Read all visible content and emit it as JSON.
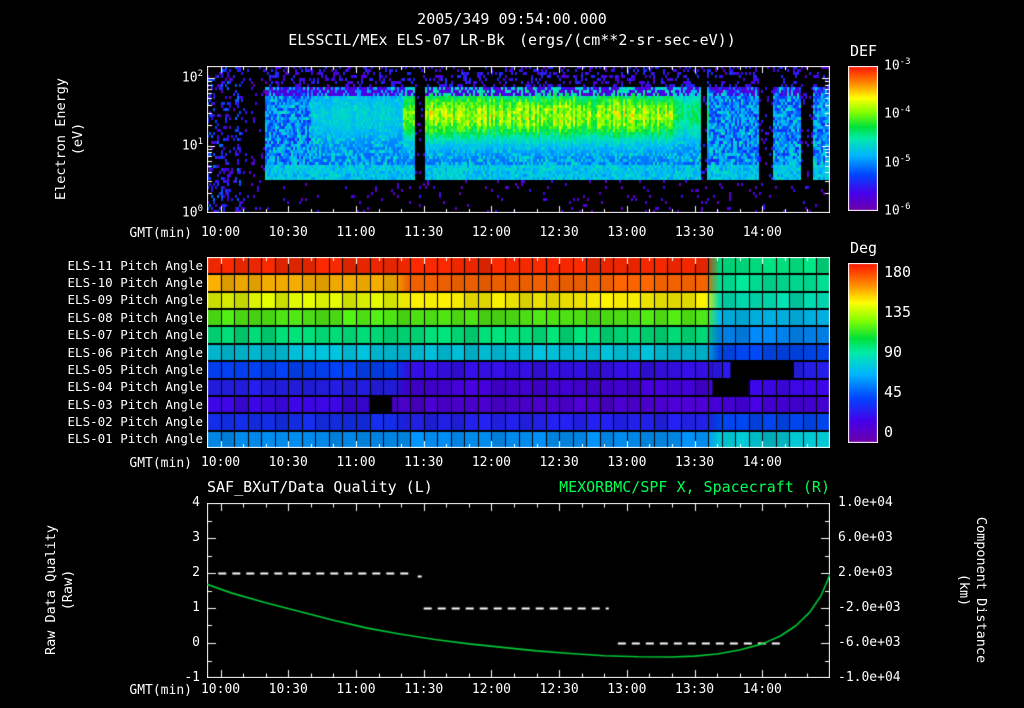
{
  "titles": {
    "datetime": "2005/349 09:54:00.000",
    "instrument": "ELSSCIL/MEx ELS-07 LR-Bk",
    "units": "(ergs/(cm**2-sr-sec-eV))"
  },
  "time_axis": {
    "label": "GMT(min)",
    "start_min": 594,
    "end_min": 870,
    "minor_step_min": 10,
    "major_ticks": [
      {
        "min": 600,
        "label": "10:00"
      },
      {
        "min": 630,
        "label": "10:30"
      },
      {
        "min": 660,
        "label": "11:00"
      },
      {
        "min": 690,
        "label": "11:30"
      },
      {
        "min": 720,
        "label": "12:00"
      },
      {
        "min": 750,
        "label": "12:30"
      },
      {
        "min": 780,
        "label": "13:00"
      },
      {
        "min": 810,
        "label": "13:30"
      },
      {
        "min": 840,
        "label": "14:00"
      }
    ]
  },
  "chart_data": [
    {
      "type": "heatmap",
      "name": "electron-energy-spectrogram",
      "title": "ELSSCIL/MEx ELS-07 LR-Bk",
      "units": "(ergs/(cm**2-sr-sec-eV))",
      "xlabel": "GMT(min)",
      "ylabel": [
        "Electron Energy",
        "(eV)"
      ],
      "y_axis": {
        "scale": "log",
        "min_ev": 1,
        "max_ev": 151,
        "log_max": 2.18,
        "ticks": [
          {
            "exp": "2"
          },
          {
            "exp": "1"
          },
          {
            "exp": "0"
          }
        ]
      },
      "colorbar": {
        "label": "DEF",
        "scale": "log",
        "min": 1e-06,
        "max": 0.001,
        "ticks": [
          {
            "exp": "-3"
          },
          {
            "exp": "-4"
          },
          {
            "exp": "-5"
          },
          {
            "exp": "-6"
          }
        ]
      },
      "features": {
        "plasma_band_ev": [
          3.2,
          75
        ],
        "plasma_band_flux_log10": -5.0,
        "enhancement_center_ev": 28,
        "enhancements": [
          {
            "t_min": [
              640,
              680
            ],
            "strength": 0.35
          },
          {
            "t_min": [
              680,
              800
            ],
            "strength": 0.95
          },
          {
            "t_min": [
              800,
              816
            ],
            "strength": 0.6
          }
        ],
        "data_gaps_min": [
          [
            603,
            606
          ],
          [
            609,
            619
          ],
          [
            686,
            690
          ],
          [
            812,
            815
          ],
          [
            838,
            844
          ],
          [
            857,
            862
          ]
        ],
        "noisy_region_min": [
          594,
          619
        ]
      }
    },
    {
      "type": "heatmap",
      "name": "pitch-angle-panel",
      "xlabel": "GMT(min)",
      "grid_columns": 46,
      "colorbar": {
        "label": "Deg",
        "min": 0,
        "max": 180,
        "ticks": [
          180,
          135,
          90,
          45,
          0
        ]
      },
      "rows": [
        {
          "label": "ELS-11 Pitch Angle",
          "segments": [
            [
              594,
              818,
              176
            ],
            [
              818,
              870,
              95
            ]
          ]
        },
        {
          "label": "ELS-10 Pitch Angle",
          "segments": [
            [
              594,
              680,
              152
            ],
            [
              680,
              818,
              165
            ],
            [
              818,
              870,
              92
            ]
          ]
        },
        {
          "label": "ELS-09 Pitch Angle",
          "segments": [
            [
              594,
              680,
              137
            ],
            [
              680,
              818,
              142
            ],
            [
              818,
              870,
              87
            ]
          ]
        },
        {
          "label": "ELS-08 Pitch Angle",
          "segments": [
            [
              594,
              818,
              116
            ],
            [
              818,
              870,
              72
            ]
          ]
        },
        {
          "label": "ELS-07 Pitch Angle",
          "segments": [
            [
              594,
              818,
              96
            ],
            [
              818,
              870,
              60
            ]
          ]
        },
        {
          "label": "ELS-06 Pitch Angle",
          "segments": [
            [
              594,
              818,
              76
            ],
            [
              818,
              870,
              46
            ]
          ]
        },
        {
          "label": "ELS-05 Pitch Angle",
          "segments": [
            [
              594,
              680,
              44
            ],
            [
              680,
              818,
              27
            ],
            [
              818,
              826,
              30
            ],
            [
              826,
              854,
              null
            ],
            [
              854,
              870,
              32
            ]
          ]
        },
        {
          "label": "ELS-04 Pitch Angle",
          "segments": [
            [
              594,
              680,
              32
            ],
            [
              680,
              818,
              20
            ],
            [
              818,
              834,
              null
            ],
            [
              834,
              870,
              24
            ]
          ]
        },
        {
          "label": "ELS-03 Pitch Angle",
          "segments": [
            [
              594,
              666,
              24
            ],
            [
              666,
              676,
              null
            ],
            [
              676,
              818,
              16
            ],
            [
              818,
              870,
              20
            ]
          ]
        },
        {
          "label": "ELS-02 Pitch Angle",
          "segments": [
            [
              594,
              680,
              38
            ],
            [
              680,
              818,
              33
            ],
            [
              818,
              870,
              46
            ]
          ]
        },
        {
          "label": "ELS-01 Pitch Angle",
          "segments": [
            [
              594,
              818,
              62
            ],
            [
              818,
              870,
              78
            ]
          ]
        }
      ]
    },
    {
      "type": "line",
      "name": "quality-and-distance",
      "title_left": "SAF_BXuT/Data Quality (L)",
      "title_right": "MEXORBMC/SPF X, Spacecraft (R)",
      "xlabel": "GMT(min)",
      "left_axis": {
        "label": [
          "Raw Data Quality",
          "(Raw)"
        ],
        "min": -1,
        "max": 4,
        "ticks": [
          4,
          3,
          2,
          1,
          0,
          -1
        ]
      },
      "right_axis": {
        "label": [
          "Component Distance",
          "(km)"
        ],
        "min": -10000,
        "max": 10000,
        "ticks": [
          "1.0e+04",
          "6.0e+03",
          "2.0e+03",
          "-2.0e+03",
          "-6.0e+03",
          "-1.0e+04"
        ]
      },
      "series": [
        {
          "name": "SAF_BXuT Data Quality",
          "axis": "left",
          "style": "dashed",
          "color": "#ffffff",
          "segments": [
            {
              "t_min": [
                599,
                685
              ],
              "value": 2
            },
            {
              "t_min": [
                690,
                772
              ],
              "value": 1
            },
            {
              "t_min": [
                776,
                848
              ],
              "value": 0
            }
          ],
          "point": {
            "t_min": 688,
            "value": 1.9
          }
        },
        {
          "name": "MEXORBMC/SPF X Spacecraft",
          "axis": "right",
          "style": "solid",
          "color": "#00c838",
          "points": [
            [
              594,
              700
            ],
            [
              605,
              -300
            ],
            [
              620,
              -1400
            ],
            [
              635,
              -2400
            ],
            [
              650,
              -3400
            ],
            [
              665,
              -4300
            ],
            [
              680,
              -5000
            ],
            [
              695,
              -5600
            ],
            [
              710,
              -6100
            ],
            [
              725,
              -6500
            ],
            [
              740,
              -6900
            ],
            [
              755,
              -7200
            ],
            [
              770,
              -7450
            ],
            [
              785,
              -7580
            ],
            [
              800,
              -7600
            ],
            [
              810,
              -7500
            ],
            [
              820,
              -7250
            ],
            [
              830,
              -6800
            ],
            [
              840,
              -6100
            ],
            [
              848,
              -5200
            ],
            [
              855,
              -4000
            ],
            [
              861,
              -2500
            ],
            [
              866,
              -600
            ],
            [
              869,
              1200
            ],
            [
              870,
              1900
            ]
          ]
        }
      ]
    }
  ],
  "colors": {
    "background": "#000000",
    "text": "#ffffff",
    "series_right_title": "#00ff55",
    "distance_curve": "#00c838",
    "quality_line": "#ffffff"
  }
}
